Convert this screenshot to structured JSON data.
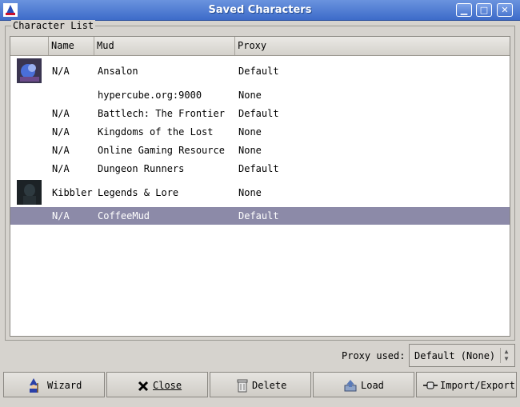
{
  "window": {
    "title": "Saved Characters",
    "controls": {
      "minimize": "▁",
      "maximize": "□",
      "close": "✕"
    }
  },
  "frame": {
    "label": "Character List"
  },
  "table": {
    "columns": [
      "",
      "Name",
      "Mud",
      "Proxy"
    ],
    "rows": [
      {
        "name": "N/A",
        "mud": "Ansalon",
        "proxy": "Default"
      },
      {
        "name": "",
        "mud": "hypercube.org:9000",
        "proxy": "None"
      },
      {
        "name": "N/A",
        "mud": "Battlech: The Frontier",
        "proxy": "Default"
      },
      {
        "name": "N/A",
        "mud": "Kingdoms of the Lost",
        "proxy": "None"
      },
      {
        "name": "N/A",
        "mud": "Online Gaming Resource",
        "proxy": "None"
      },
      {
        "name": "N/A",
        "mud": "Dungeon Runners",
        "proxy": "Default"
      },
      {
        "name": "Kibbler",
        "mud": "Legends & Lore",
        "proxy": "None"
      },
      {
        "name": "N/A",
        "mud": "CoffeeMud",
        "proxy": "Default"
      }
    ]
  },
  "proxy": {
    "label": "Proxy used:",
    "value": "Default (None)"
  },
  "buttons": {
    "wizard": "Wizard",
    "close": "Close",
    "delete": "Delete",
    "load": "Load",
    "import_export": "Import/Export"
  },
  "colors": {
    "selection": "#8c8aa8",
    "titlebar": "#4a76cf"
  }
}
